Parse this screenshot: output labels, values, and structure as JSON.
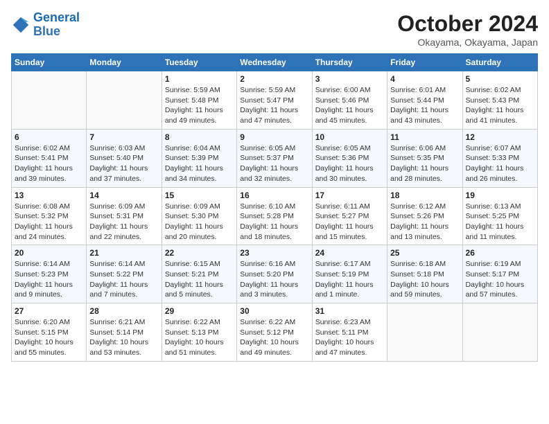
{
  "header": {
    "logo_general": "General",
    "logo_blue": "Blue",
    "month_title": "October 2024",
    "location": "Okayama, Okayama, Japan"
  },
  "days_of_week": [
    "Sunday",
    "Monday",
    "Tuesday",
    "Wednesday",
    "Thursday",
    "Friday",
    "Saturday"
  ],
  "weeks": [
    [
      {
        "day": "",
        "info": ""
      },
      {
        "day": "",
        "info": ""
      },
      {
        "day": "1",
        "info": "Sunrise: 5:59 AM\nSunset: 5:48 PM\nDaylight: 11 hours and 49 minutes."
      },
      {
        "day": "2",
        "info": "Sunrise: 5:59 AM\nSunset: 5:47 PM\nDaylight: 11 hours and 47 minutes."
      },
      {
        "day": "3",
        "info": "Sunrise: 6:00 AM\nSunset: 5:46 PM\nDaylight: 11 hours and 45 minutes."
      },
      {
        "day": "4",
        "info": "Sunrise: 6:01 AM\nSunset: 5:44 PM\nDaylight: 11 hours and 43 minutes."
      },
      {
        "day": "5",
        "info": "Sunrise: 6:02 AM\nSunset: 5:43 PM\nDaylight: 11 hours and 41 minutes."
      }
    ],
    [
      {
        "day": "6",
        "info": "Sunrise: 6:02 AM\nSunset: 5:41 PM\nDaylight: 11 hours and 39 minutes."
      },
      {
        "day": "7",
        "info": "Sunrise: 6:03 AM\nSunset: 5:40 PM\nDaylight: 11 hours and 37 minutes."
      },
      {
        "day": "8",
        "info": "Sunrise: 6:04 AM\nSunset: 5:39 PM\nDaylight: 11 hours and 34 minutes."
      },
      {
        "day": "9",
        "info": "Sunrise: 6:05 AM\nSunset: 5:37 PM\nDaylight: 11 hours and 32 minutes."
      },
      {
        "day": "10",
        "info": "Sunrise: 6:05 AM\nSunset: 5:36 PM\nDaylight: 11 hours and 30 minutes."
      },
      {
        "day": "11",
        "info": "Sunrise: 6:06 AM\nSunset: 5:35 PM\nDaylight: 11 hours and 28 minutes."
      },
      {
        "day": "12",
        "info": "Sunrise: 6:07 AM\nSunset: 5:33 PM\nDaylight: 11 hours and 26 minutes."
      }
    ],
    [
      {
        "day": "13",
        "info": "Sunrise: 6:08 AM\nSunset: 5:32 PM\nDaylight: 11 hours and 24 minutes."
      },
      {
        "day": "14",
        "info": "Sunrise: 6:09 AM\nSunset: 5:31 PM\nDaylight: 11 hours and 22 minutes."
      },
      {
        "day": "15",
        "info": "Sunrise: 6:09 AM\nSunset: 5:30 PM\nDaylight: 11 hours and 20 minutes."
      },
      {
        "day": "16",
        "info": "Sunrise: 6:10 AM\nSunset: 5:28 PM\nDaylight: 11 hours and 18 minutes."
      },
      {
        "day": "17",
        "info": "Sunrise: 6:11 AM\nSunset: 5:27 PM\nDaylight: 11 hours and 15 minutes."
      },
      {
        "day": "18",
        "info": "Sunrise: 6:12 AM\nSunset: 5:26 PM\nDaylight: 11 hours and 13 minutes."
      },
      {
        "day": "19",
        "info": "Sunrise: 6:13 AM\nSunset: 5:25 PM\nDaylight: 11 hours and 11 minutes."
      }
    ],
    [
      {
        "day": "20",
        "info": "Sunrise: 6:14 AM\nSunset: 5:23 PM\nDaylight: 11 hours and 9 minutes."
      },
      {
        "day": "21",
        "info": "Sunrise: 6:14 AM\nSunset: 5:22 PM\nDaylight: 11 hours and 7 minutes."
      },
      {
        "day": "22",
        "info": "Sunrise: 6:15 AM\nSunset: 5:21 PM\nDaylight: 11 hours and 5 minutes."
      },
      {
        "day": "23",
        "info": "Sunrise: 6:16 AM\nSunset: 5:20 PM\nDaylight: 11 hours and 3 minutes."
      },
      {
        "day": "24",
        "info": "Sunrise: 6:17 AM\nSunset: 5:19 PM\nDaylight: 11 hours and 1 minute."
      },
      {
        "day": "25",
        "info": "Sunrise: 6:18 AM\nSunset: 5:18 PM\nDaylight: 10 hours and 59 minutes."
      },
      {
        "day": "26",
        "info": "Sunrise: 6:19 AM\nSunset: 5:17 PM\nDaylight: 10 hours and 57 minutes."
      }
    ],
    [
      {
        "day": "27",
        "info": "Sunrise: 6:20 AM\nSunset: 5:15 PM\nDaylight: 10 hours and 55 minutes."
      },
      {
        "day": "28",
        "info": "Sunrise: 6:21 AM\nSunset: 5:14 PM\nDaylight: 10 hours and 53 minutes."
      },
      {
        "day": "29",
        "info": "Sunrise: 6:22 AM\nSunset: 5:13 PM\nDaylight: 10 hours and 51 minutes."
      },
      {
        "day": "30",
        "info": "Sunrise: 6:22 AM\nSunset: 5:12 PM\nDaylight: 10 hours and 49 minutes."
      },
      {
        "day": "31",
        "info": "Sunrise: 6:23 AM\nSunset: 5:11 PM\nDaylight: 10 hours and 47 minutes."
      },
      {
        "day": "",
        "info": ""
      },
      {
        "day": "",
        "info": ""
      }
    ]
  ]
}
